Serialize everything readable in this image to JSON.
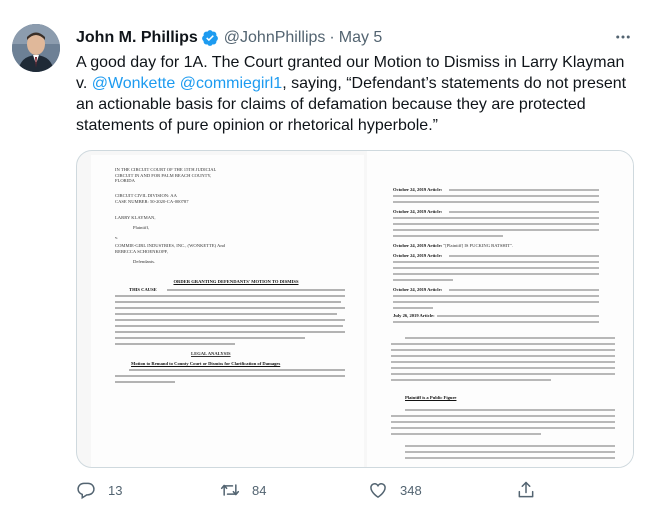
{
  "author": {
    "name": "John M. Phillips",
    "handle": "@JohnPhillips",
    "separator": "·",
    "date": "May 5"
  },
  "tweet": {
    "text_part1": "A good day for 1A. The Court granted our Motion to Dismiss in Larry Klayman v. ",
    "mention1": "@Wonkette",
    "mention2": "@commiegirl1",
    "text_part2": ", saying, “Defendant’s statements do not present an actionable basis for claims of defamation because they are protected statements of pure opinion or rhetorical hyperbole.”"
  },
  "document": {
    "court_header": "IN THE CIRCUIT COURT OF THE 15TH JUDICIAL CIRCUIT IN AND FOR PALM BEACH COUNTY, FLORIDA",
    "division": "CIRCUIT CIVIL DIVISION: AA",
    "case_number": "CASE NUMBER: 50-2020-CA-000787",
    "plaintiff": "LARRY KLAYMAN,",
    "plaintiff_role": "Plaintiff,",
    "versus": "v.",
    "defendant": "COMMIE-GIRL INDUSTRIES, INC., (WONKETTE) And REBECCA SCHOENKOPF,",
    "defendant_role": "Defendants.",
    "order_title": "ORDER GRANTING DEFENDANTS' MOTION TO DISMISS",
    "cause_lead": "THIS CAUSE",
    "section_legal": "LEGAL ANALYSIS",
    "section_1": "Motion to Remand to County Court or Dismiss for Clarification of Damages",
    "section_2": "Plaintiff is a Public Figure",
    "art1_lead": "October 24, 2019 Article:",
    "art2_lead": "October 24, 2019 Article:",
    "art3_lead": "October 24, 2019 Article:",
    "art3_text": "\"[Plaintiff] IS FUCKING BATSHIT\".",
    "art4_lead": "October 24, 2019 Article:",
    "art5_lead": "October 24, 2019 Article:",
    "art6_lead": "July 26, 2019 Article:"
  },
  "actions": {
    "replies": "13",
    "retweets": "84",
    "likes": "348"
  },
  "colors": {
    "link": "#1d9bf0",
    "verified": "#1d9bf0",
    "secondary_text": "#536471",
    "border": "#cfd9de"
  },
  "icons": {
    "verified": "verified-badge-icon",
    "more": "more-dots-icon",
    "reply": "reply-bubble-icon",
    "retweet": "retweet-arrows-icon",
    "like": "heart-icon",
    "share": "share-upload-icon"
  }
}
